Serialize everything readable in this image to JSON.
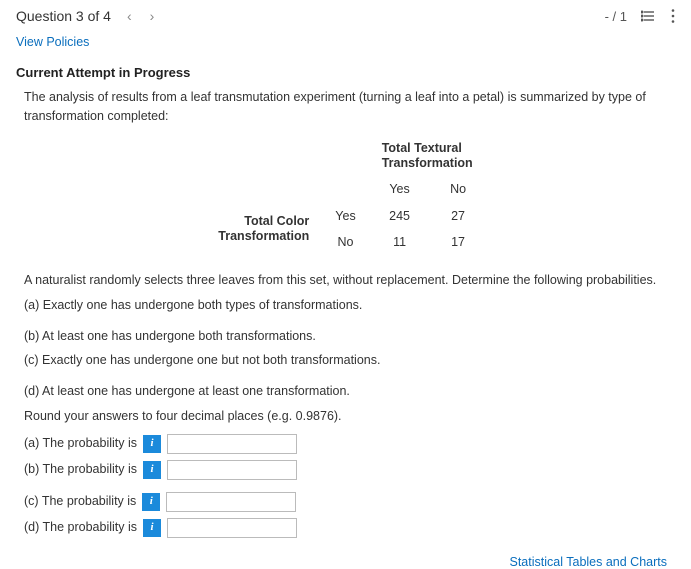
{
  "header": {
    "title": "Question 3 of 4",
    "score": "- / 1"
  },
  "links": {
    "policies": "View Policies",
    "stats": "Statistical Tables and Charts"
  },
  "section": {
    "attempt": "Current Attempt in Progress"
  },
  "intro": "The analysis of results from a leaf transmutation experiment (turning a leaf into a petal) is summarized by type of transformation completed:",
  "table": {
    "top_header_l1": "Total Textural",
    "top_header_l2": "Transformation",
    "col_yes": "Yes",
    "col_no": "No",
    "row_header_l1": "Total Color",
    "row_header_l2": "Transformation",
    "row_yes": "Yes",
    "row_no": "No",
    "cells": {
      "yy": "245",
      "yn": "27",
      "ny": "11",
      "nn": "17"
    }
  },
  "body": {
    "p1": "A naturalist randomly selects three leaves from this set, without replacement. Determine the following probabilities.",
    "pa": "(a) Exactly one has undergone both types of transformations.",
    "pb": "(b) At least one has undergone both transformations.",
    "pc": "(c) Exactly one has undergone one but not both transformations.",
    "pd": "(d) At least one has undergone at least one transformation.",
    "round": "Round your answers to four decimal places (e.g. 0.9876)."
  },
  "answers": {
    "a": "(a) The probability is",
    "b": "(b) The probability is",
    "c": "(c) The probability is",
    "d": "(d) The probability is",
    "info": "i"
  }
}
